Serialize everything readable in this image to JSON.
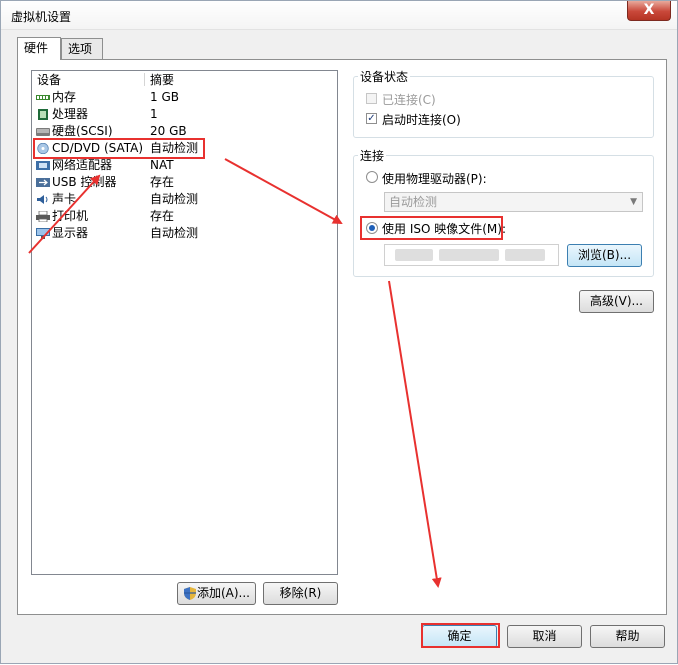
{
  "window": {
    "title": "虚拟机设置",
    "close": "X"
  },
  "tabs": [
    {
      "label": "硬件"
    },
    {
      "label": "选项"
    }
  ],
  "device_list": {
    "headers": {
      "device": "设备",
      "summary": "摘要"
    },
    "rows": [
      {
        "name": "内存",
        "value": "1 GB",
        "icon": "memory-icon"
      },
      {
        "name": "处理器",
        "value": "1",
        "icon": "processor-icon"
      },
      {
        "name": "硬盘(SCSI)",
        "value": "20 GB",
        "icon": "hard-disk-icon"
      },
      {
        "name": "CD/DVD (SATA)",
        "value": "自动检测",
        "icon": "cd-dvd-icon"
      },
      {
        "name": "网络适配器",
        "value": "NAT",
        "icon": "network-adapter-icon"
      },
      {
        "name": "USB 控制器",
        "value": "存在",
        "icon": "usb-icon"
      },
      {
        "name": "声卡",
        "value": "自动检测",
        "icon": "sound-card-icon"
      },
      {
        "name": "打印机",
        "value": "存在",
        "icon": "printer-icon"
      },
      {
        "name": "显示器",
        "value": "自动检测",
        "icon": "display-icon"
      }
    ],
    "add_button": "添加(A)...",
    "remove_button": "移除(R)"
  },
  "device_status": {
    "title": "设备状态",
    "connected": {
      "label": "已连接(C)",
      "checked": false,
      "enabled": false
    },
    "connect_at_power_on": {
      "label": "启动时连接(O)",
      "checked": true
    }
  },
  "connection": {
    "title": "连接",
    "use_physical_drive": {
      "label": "使用物理驱动器(P):",
      "selected": false
    },
    "physical_drive_select": {
      "value": "自动检测"
    },
    "use_iso_image": {
      "label": "使用 ISO 映像文件(M):",
      "selected": true
    },
    "iso_path": {
      "value": ""
    },
    "browse_button": "浏览(B)...",
    "advanced_button": "高级(V)..."
  },
  "footer": {
    "ok_button": "确定",
    "cancel_button": "取消",
    "help_button": "帮助"
  },
  "colors": {
    "highlight_box": "#e8312f",
    "radio_selected": "#1e5fb8"
  }
}
